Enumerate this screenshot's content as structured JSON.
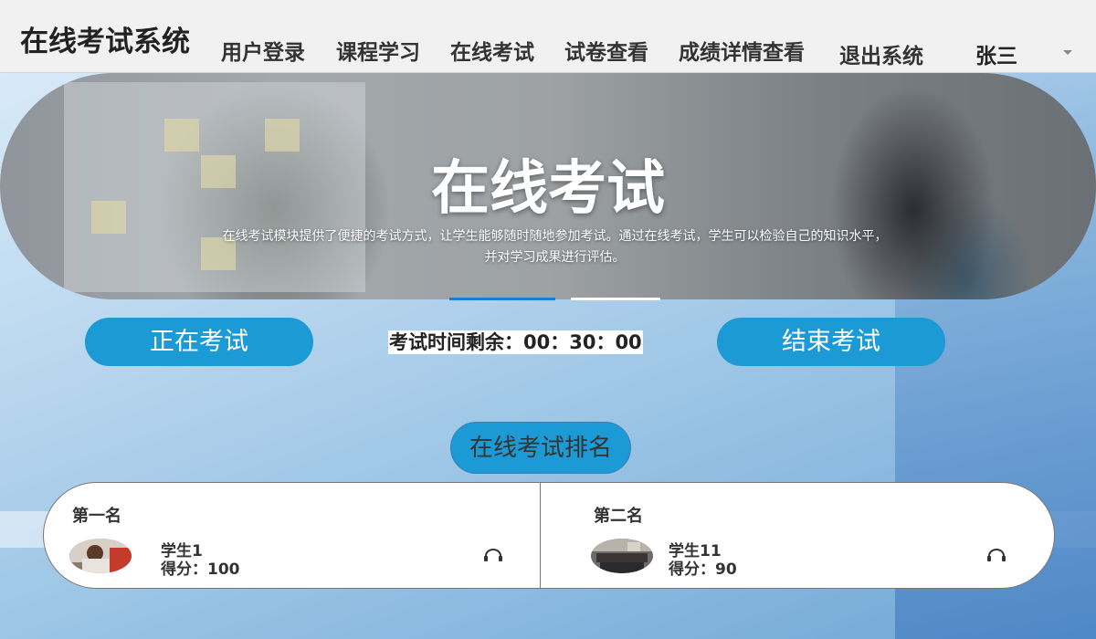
{
  "app": {
    "brand": "在线考试系统"
  },
  "nav": {
    "items": [
      {
        "label": "用户登录"
      },
      {
        "label": "课程学习"
      },
      {
        "label": "在线考试"
      },
      {
        "label": "试卷查看"
      },
      {
        "label": "成绩详情查看"
      },
      {
        "label": "退出系统"
      }
    ],
    "user": "张三",
    "user_menu_icon": "chevron-down-icon"
  },
  "banner": {
    "title": "在线考试",
    "description": "在线考试模块提供了便捷的考试方式，让学生能够随时随地参加考试。通过在线考试，学生可以检验自己的知识水平，并对学习成果进行评估。",
    "indicator_active_color": "#1b7fd1"
  },
  "exam": {
    "status_button": "正在考试",
    "timer_label": "考试时间剩余：",
    "timer_value": "00：30：00",
    "end_button": "结束考试",
    "accent_color": "#1b9ad6"
  },
  "ranking": {
    "title": "在线考试排名",
    "entries": [
      {
        "rank_label": "第一名",
        "name": "学生1",
        "score_label": "得分：",
        "score": "100",
        "icon": "headphones-icon"
      },
      {
        "rank_label": "第二名",
        "name": "学生11",
        "score_label": "得分：",
        "score": "90",
        "icon": "headphones-icon"
      }
    ]
  }
}
